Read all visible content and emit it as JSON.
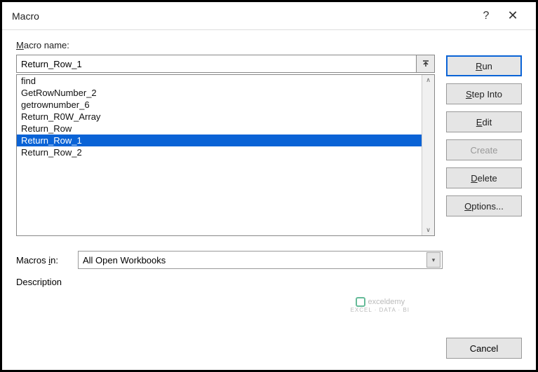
{
  "titlebar": {
    "title": "Macro"
  },
  "labels": {
    "macro_name": "acro name:",
    "macro_name_prefix": "M",
    "macros_in": "Macros ",
    "macros_in_underline": "i",
    "macros_in_suffix": "n:",
    "description": "Description"
  },
  "macro_name_input": "Return_Row_1",
  "macro_list": [
    {
      "label": "find",
      "selected": false
    },
    {
      "label": "GetRowNumber_2",
      "selected": false
    },
    {
      "label": "getrownumber_6",
      "selected": false
    },
    {
      "label": "Return_R0W_Array",
      "selected": false
    },
    {
      "label": "Return_Row",
      "selected": false
    },
    {
      "label": "Return_Row_1",
      "selected": true
    },
    {
      "label": "Return_Row_2",
      "selected": false
    }
  ],
  "macros_in_value": "All Open Workbooks",
  "buttons": {
    "run_prefix": "R",
    "run_suffix": "un",
    "step_prefix": "S",
    "step_suffix": "tep Into",
    "edit_prefix": "E",
    "edit_suffix": "dit",
    "create_prefix": "C",
    "create_suffix": "reate",
    "delete_prefix": "D",
    "delete_suffix": "elete",
    "options_prefix": "O",
    "options_suffix": "ptions...",
    "cancel": "Cancel"
  },
  "watermark": {
    "name": "exceldemy",
    "sub": "EXCEL · DATA · BI"
  }
}
